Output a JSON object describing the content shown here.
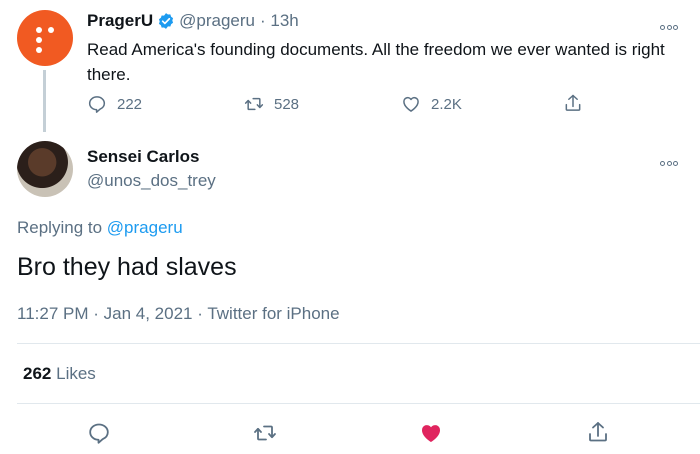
{
  "parent_tweet": {
    "name": "PragerU",
    "handle": "@prageru",
    "time": "· 13h",
    "text": "Read America's founding documents. All the freedom we ever wanted is right there.",
    "stats": {
      "replies": "222",
      "retweets": "528",
      "likes": "2.2K"
    }
  },
  "reply_tweet": {
    "name": "Sensei Carlos",
    "handle": "@unos_dos_trey",
    "replying_prefix": "Replying to",
    "replying_to": "@prageru",
    "text": "Bro they had slaves",
    "time": "11:27 PM",
    "date": "Jan 4, 2021",
    "source": "Twitter for iPhone",
    "like_count": "262",
    "like_label": "Likes"
  },
  "colors": {
    "brand_orange": "#f15a22",
    "link_blue": "#1d9bf0",
    "heart_red": "#e0245e",
    "secondary_gray": "#5b7083"
  },
  "icons": [
    "reply-icon",
    "retweet-icon",
    "like-icon",
    "share-icon",
    "verified-badge-icon",
    "more-options-icon"
  ]
}
